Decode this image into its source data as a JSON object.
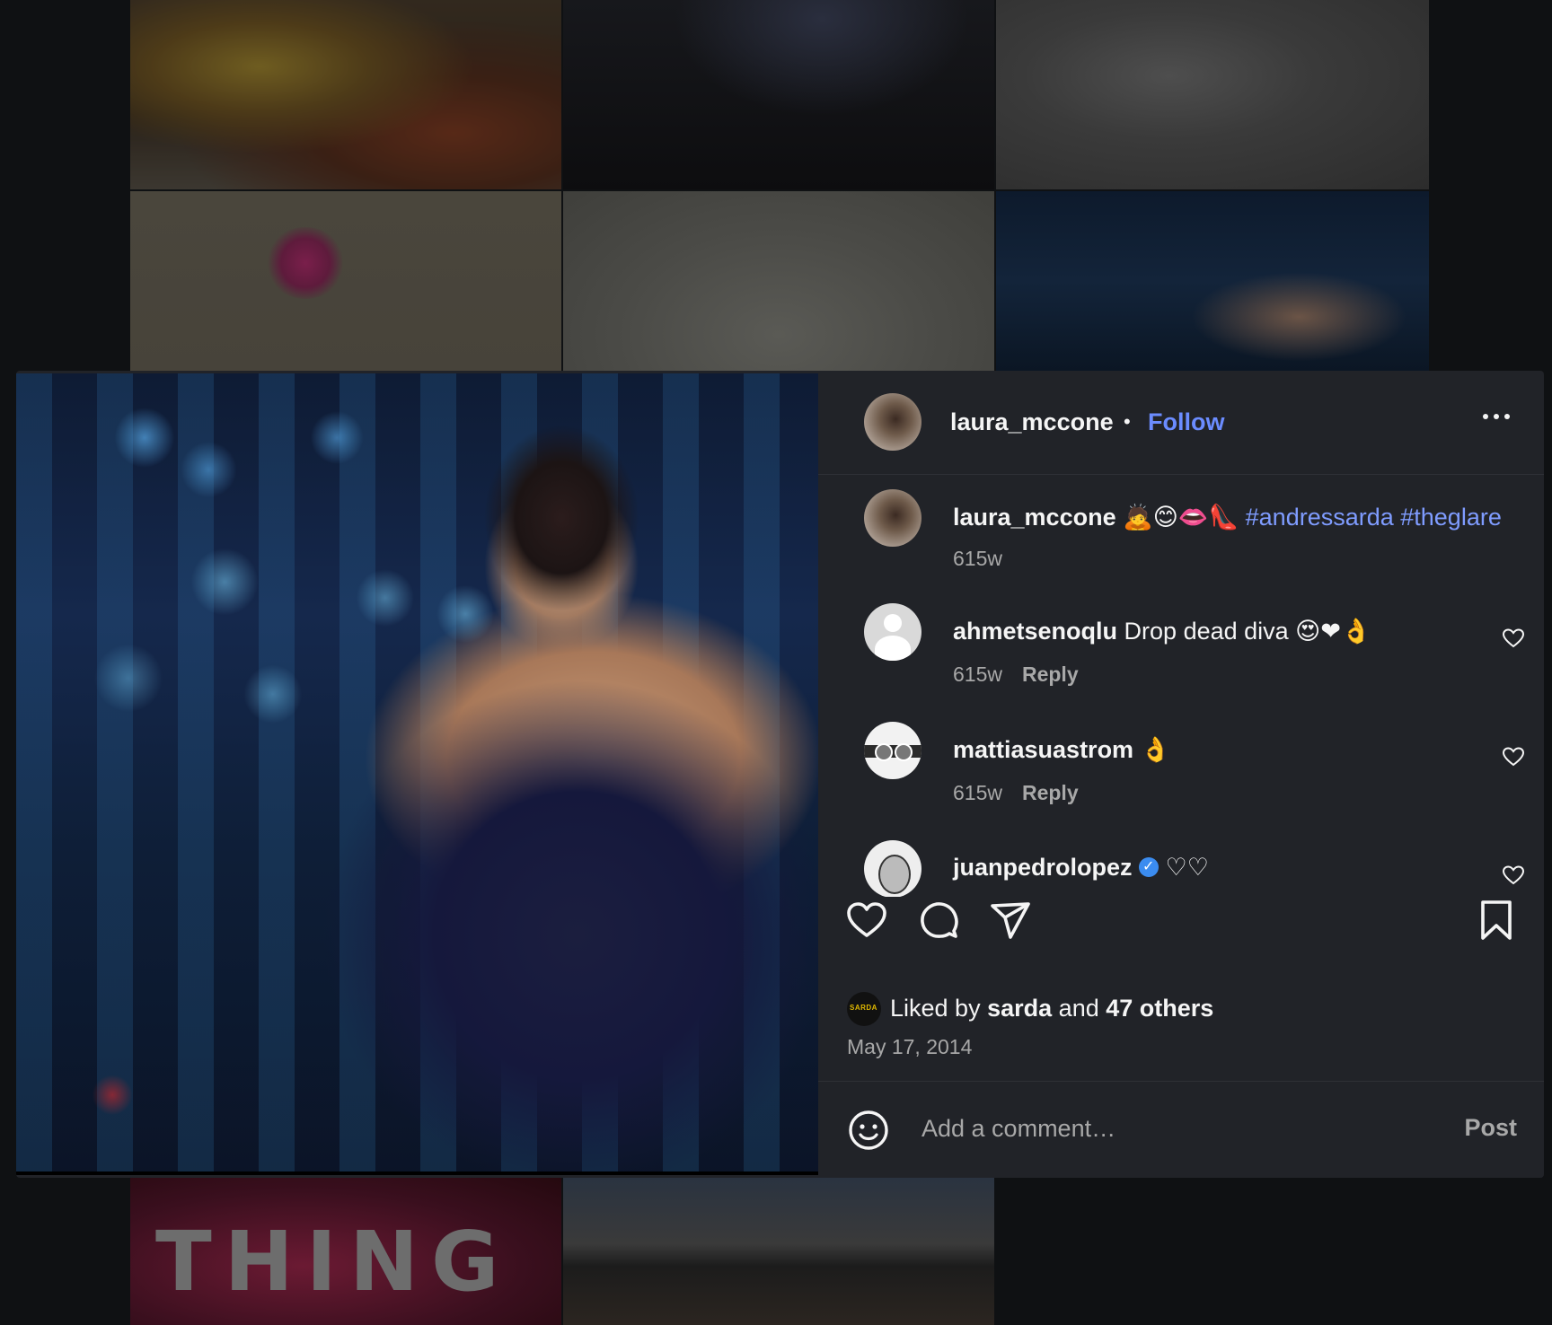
{
  "background": {
    "tile_word": "THING"
  },
  "post": {
    "author": "laura_mccone",
    "follow_label": "Follow",
    "separator": "•"
  },
  "comments": [
    {
      "user": "laura_mccone",
      "text": "🙇😊👄👠",
      "tags": "#andressarda #theglare",
      "time": "615w"
    },
    {
      "user": "ahmetsenoqlu",
      "text": "Drop dead diva 😍❤👌",
      "time": "615w",
      "reply": "Reply"
    },
    {
      "user": "mattiasuastrom",
      "text": "👌",
      "time": "615w",
      "reply": "Reply"
    },
    {
      "user": "juanpedrolopez",
      "text": "♡♡"
    }
  ],
  "likes": {
    "prefix": "Liked by",
    "user": "sarda",
    "and": "and",
    "others": "47 others",
    "avatar_text": "SARDA"
  },
  "date": "May 17, 2014",
  "composer": {
    "placeholder": "Add a comment…",
    "post_label": "Post"
  },
  "colors": {
    "accent": "#6b8cff",
    "hashtag": "#7f9cff",
    "panel": "#212328",
    "page": "#0f1113",
    "verified": "#3b8cf0"
  },
  "icons": {
    "more": "more-horizontal-icon",
    "like": "heart-icon",
    "comment": "comment-bubble-icon",
    "share": "paper-plane-icon",
    "save": "bookmark-icon",
    "emoji": "smiley-icon"
  }
}
